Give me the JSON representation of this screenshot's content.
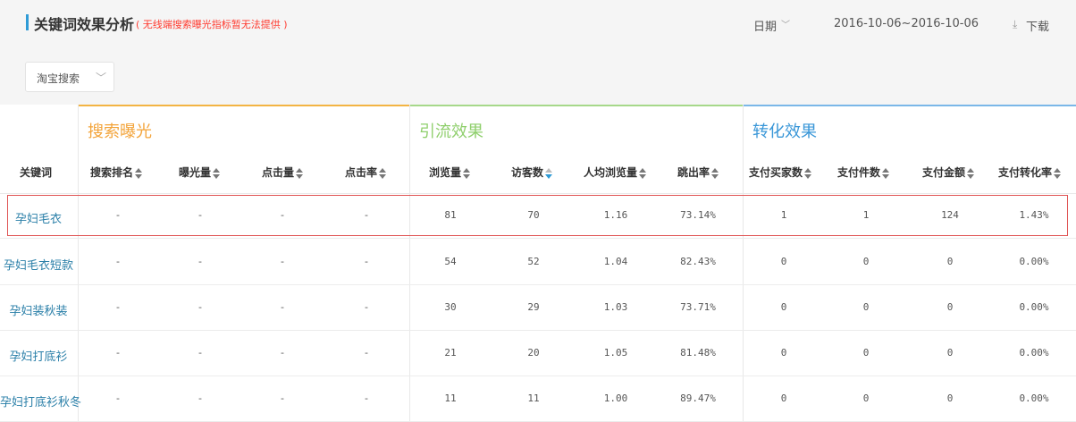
{
  "header": {
    "title": "关键词效果分析",
    "subtitle": "( 无线端搜索曝光指标暂无法提供 )",
    "date_label": "日期",
    "date_range": "2016-10-06~2016-10-06",
    "download_label": "下载"
  },
  "filter": {
    "source_value": "淘宝搜索"
  },
  "groups": [
    {
      "label": "搜索曝光",
      "color": "#f3b443"
    },
    {
      "label": "引流效果",
      "color": "#a6d88a"
    },
    {
      "label": "转化效果",
      "color": "#7ab7e8"
    }
  ],
  "columns": [
    "关键词",
    "搜索排名",
    "曝光量",
    "点击量",
    "点击率",
    "浏览量",
    "访客数",
    "人均浏览量",
    "跳出率",
    "支付买家数",
    "支付件数",
    "支付金额",
    "支付转化率"
  ],
  "rows": [
    {
      "keyword": "孕妇毛衣",
      "values": [
        "-",
        "-",
        "-",
        "-",
        "81",
        "70",
        "1.16",
        "73.14%",
        "1",
        "1",
        "124",
        "1.43%"
      ]
    },
    {
      "keyword": "孕妇毛衣短款",
      "values": [
        "-",
        "-",
        "-",
        "-",
        "54",
        "52",
        "1.04",
        "82.43%",
        "0",
        "0",
        "0",
        "0.00%"
      ]
    },
    {
      "keyword": "孕妇装秋装",
      "values": [
        "-",
        "-",
        "-",
        "-",
        "30",
        "29",
        "1.03",
        "73.71%",
        "0",
        "0",
        "0",
        "0.00%"
      ]
    },
    {
      "keyword": "孕妇打底衫",
      "values": [
        "-",
        "-",
        "-",
        "-",
        "21",
        "20",
        "1.05",
        "81.48%",
        "0",
        "0",
        "0",
        "0.00%"
      ]
    },
    {
      "keyword": "孕妇打底衫秋冬",
      "values": [
        "-",
        "-",
        "-",
        "-",
        "11",
        "11",
        "1.00",
        "89.47%",
        "0",
        "0",
        "0",
        "0.00%"
      ]
    }
  ],
  "colors": {
    "accent": "#2f9bd6",
    "link": "#2a7fa8",
    "highlight_border": "#e05555",
    "warning_text": "#ff3b30"
  },
  "icons": {
    "date_dropdown": "chevron-down-icon",
    "download": "download-icon",
    "sort": "sort-icon"
  }
}
